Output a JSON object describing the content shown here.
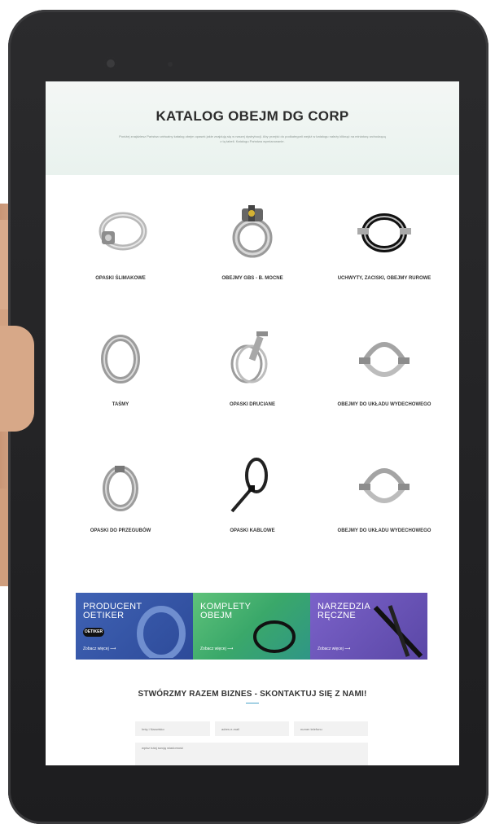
{
  "hero": {
    "title": "KATALOG OBEJM DG CORP",
    "subtitle": "Poniżej znajdziesz Państwo wirtualny katalog obejm opasek jakie znajdują się w naszej dystrybucji. Aby przejść do podkategorii wejdź w katalogu należy kliknąć na miniaturę wchodzącą z tą tabeli. Katalogu Państwa wymiarowanie."
  },
  "categories": [
    {
      "label": "OPASKI ŚLIMAKOWE",
      "icon": "worm-clamp-icon"
    },
    {
      "label": "OBEJMY GBS - B. MOCNE",
      "icon": "gbs-clamp-icon"
    },
    {
      "label": "UCHWYTY, ZACISKI, OBEJMY RUROWE",
      "icon": "pipe-clamp-icon"
    },
    {
      "label": "TAŚMY",
      "icon": "band-clamp-icon"
    },
    {
      "label": "OPASKI DRUCIANE",
      "icon": "wire-clamp-icon"
    },
    {
      "label": "OBEJMY DO UKŁADU WYDECHOWEGO",
      "icon": "exhaust-clamp-icon"
    },
    {
      "label": "OPASKI DO PRZEGUBÓW",
      "icon": "joint-clamp-icon"
    },
    {
      "label": "OPASKI KABLOWE",
      "icon": "cable-tie-icon"
    },
    {
      "label": "OBEJMY DO UKŁADU WYDECHOWEGO",
      "icon": "exhaust-clamp-icon"
    }
  ],
  "banners": [
    {
      "line1": "PRODUCENT",
      "line2": "OETIKER",
      "more": "Zobacz więcej ⟶",
      "logo": "OETIKER",
      "color": "#3f62b4"
    },
    {
      "line1": "KOMPLETY",
      "line2": "OBEJM",
      "more": "Zobacz więcej ⟶",
      "color": "#4bb872"
    },
    {
      "line1": "NARZEDZIA",
      "line2": "RĘCZNE",
      "more": "Zobacz więcej ⟶",
      "color": "#7b62c9"
    }
  ],
  "contact": {
    "title": "STWÓRZMY RAZEM BIZNES - SKONTAKTUJ SIĘ Z NAMI!",
    "name_placeholder": "Imię i Nazwisko",
    "email_placeholder": "adres e-mail",
    "phone_placeholder": "numer telefonu",
    "message_placeholder": "wpisz tutaj swoją wiadomość"
  }
}
